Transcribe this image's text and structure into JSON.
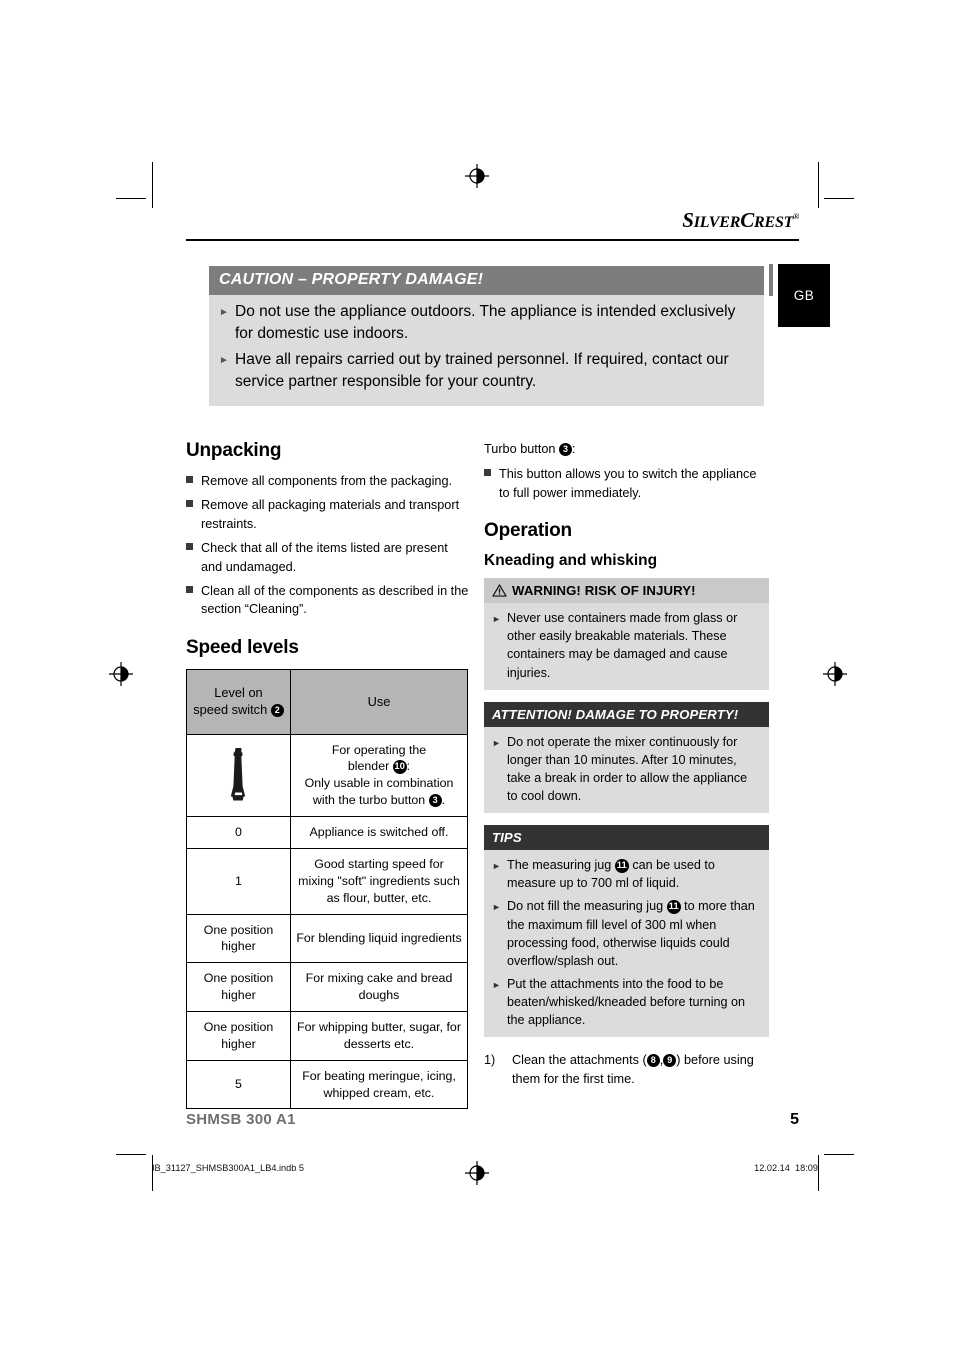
{
  "brand": {
    "name_part1": "S",
    "name_part2": "ILVER",
    "name_part3": "C",
    "name_part4": "REST",
    "registered": "®"
  },
  "language_tab": {
    "label": "GB"
  },
  "caution": {
    "heading": "CAUTION – PROPERTY DAMAGE!",
    "items": [
      "Do not use the appliance outdoors. The appliance is intended exclusively for domestic use indoors.",
      "Have all repairs carried out by trained personnel. If required, contact our service partner responsible for your country."
    ],
    "bullet_glyph": "►"
  },
  "left_column": {
    "unpacking": {
      "heading": "Unpacking",
      "items": [
        "Remove all components from the packaging.",
        "Remove all packaging materials and transport restraints.",
        "Check that all of the items listed are present and undamaged.",
        "Clean all of the components as described in the section “Cleaning”."
      ]
    },
    "speed_levels": {
      "heading": "Speed levels",
      "table": {
        "columns": [
          "Level on speed switch",
          "Use"
        ],
        "column1_header_prefix": "Level on",
        "column1_header_suffix": "speed switch",
        "column1_header_badge": "2",
        "column2_header": "Use",
        "rows": [
          {
            "level": "",
            "level_icon": "blender-attachment-icon",
            "use_line1": "For operating the",
            "use_line2_prefix": "blender",
            "use_line2_badge": "10",
            "use_line2_suffix": ":",
            "use_line3": "Only usable in combination",
            "use_line4_prefix": "with the turbo button",
            "use_line4_badge": "3",
            "use_line4_suffix": "."
          },
          {
            "level": "0",
            "use": "Appliance is switched off."
          },
          {
            "level": "1",
            "use": "Good starting speed for mixing \"soft\" ingredients such as flour, butter, etc."
          },
          {
            "level": "One position higher",
            "use": "For blending liquid ingredients"
          },
          {
            "level": "One position higher",
            "use": "For mixing cake and bread doughs"
          },
          {
            "level": "One position higher",
            "use": "For whipping butter, sugar, for desserts etc."
          },
          {
            "level": "5",
            "use": "For beating meringue, icing, whipped cream, etc."
          }
        ]
      }
    }
  },
  "right_column": {
    "turbo": {
      "label_prefix": "Turbo button",
      "label_badge": "3",
      "label_suffix": ":",
      "items": [
        "This button allows you to switch the appliance to full power immediately."
      ]
    },
    "operation": {
      "heading": "Operation",
      "subheading": "Kneading and whisking"
    },
    "warning_box": {
      "heading": "WARNING! RISK OF INJURY!",
      "icon": "warning-triangle-icon",
      "items": [
        "Never use containers made from glass or other easily breakable materials. These containers may be damaged and cause injuries."
      ],
      "bullet_glyph": "►"
    },
    "attention_box": {
      "heading": "ATTENTION! DAMAGE TO PROPERTY!",
      "items": [
        "Do not operate the mixer continuously for longer than 10 minutes. After 10 minutes, take a break in order to allow the appliance to cool down."
      ],
      "bullet_glyph": "►"
    },
    "tips_box": {
      "heading": "TIPS",
      "bullet_glyph": "►",
      "items": [
        {
          "prefix": "The measuring jug",
          "badge": "11",
          "suffix": "can be used to measure up to 700 ml of liquid."
        },
        {
          "prefix": "Do not fill the measuring jug",
          "badge": "11",
          "suffix": "to more than the maximum fill level of 300 ml when processing food, otherwise liquids could overflow/splash out."
        },
        {
          "prefix": "Put the attachments into the food to be beaten/whisked/kneaded before turning on the appliance.",
          "badge": "",
          "suffix": ""
        }
      ]
    },
    "step": {
      "number": "1)",
      "text_prefix": "Clean the attachments (",
      "badge_a": "8",
      "separator": ",",
      "badge_b": "9",
      "text_suffix": ") before using them for the first time."
    }
  },
  "footer": {
    "model": "SHMSB 300 A1",
    "page_number": "5"
  },
  "print_footer": {
    "filename": "IB_31127_SHMSB300A1_LB4.indb   5",
    "date": "12.02.14",
    "time": "18:09"
  },
  "colors": {
    "caution_header_bg": "#7d7d7d",
    "notice_light_bg": "#dcdcdc",
    "warn_header_bg": "#c9c9c9",
    "dark_header_bg": "#333333",
    "table_header_bg": "#b5b5b5",
    "model_text": "#6f6f6f"
  }
}
